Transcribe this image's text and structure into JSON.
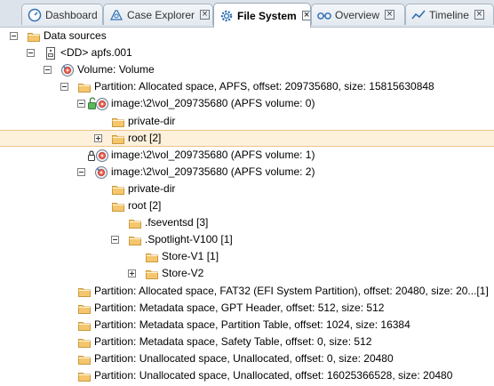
{
  "tabs": [
    {
      "label": "Dashboard",
      "icon": "gauge-icon",
      "closable": false,
      "active": false
    },
    {
      "label": "Case Explorer",
      "icon": "case-explorer-icon",
      "closable": true,
      "active": false
    },
    {
      "label": "File System",
      "icon": "gear-icon",
      "closable": true,
      "active": true
    },
    {
      "label": "Overview",
      "icon": "glasses-icon",
      "closable": true,
      "active": false
    },
    {
      "label": "Timeline",
      "icon": "timeline-icon",
      "closable": true,
      "active": false
    }
  ],
  "tab_close_glyph": "×",
  "tree": [
    {
      "level": 0,
      "toggle": "minus",
      "icon": "folder-icon",
      "label": "Data sources"
    },
    {
      "level": 1,
      "toggle": "minus",
      "icon": "disk-image-icon",
      "label": "<DD> apfs.001"
    },
    {
      "level": 2,
      "toggle": "minus",
      "icon": "volume-icon",
      "label": "Volume: Volume"
    },
    {
      "level": 3,
      "toggle": "minus",
      "icon": "folder-icon",
      "label": "Partition: Allocated space, APFS, offset: 209735680, size: 15815630848"
    },
    {
      "level": 4,
      "toggle": "minus",
      "icon": "unlocked-volume-icon",
      "label": "image:\\2\\vol_209735680 (APFS volume: 0)"
    },
    {
      "level": 5,
      "toggle": "none",
      "icon": "folder-icon",
      "label": "private-dir"
    },
    {
      "level": 5,
      "toggle": "plus",
      "icon": "folder-icon",
      "label": "root [2]",
      "selected": true
    },
    {
      "level": 4,
      "toggle": "none",
      "icon": "locked-volume-icon",
      "label": "image:\\2\\vol_209735680 (APFS volume: 1)"
    },
    {
      "level": 4,
      "toggle": "minus",
      "icon": "volume-icon",
      "label": "image:\\2\\vol_209735680 (APFS volume: 2)"
    },
    {
      "level": 5,
      "toggle": "none",
      "icon": "folder-icon",
      "label": "private-dir"
    },
    {
      "level": 5,
      "toggle": "none",
      "icon": "folder-icon",
      "label": "root [2]"
    },
    {
      "level": 6,
      "toggle": "none",
      "icon": "folder-icon",
      "label": ".fseventsd [3]"
    },
    {
      "level": 6,
      "toggle": "minus",
      "icon": "folder-icon",
      "label": ".Spotlight-V100 [1]"
    },
    {
      "level": 7,
      "toggle": "none",
      "icon": "folder-icon",
      "label": "Store-V1 [1]"
    },
    {
      "level": 7,
      "toggle": "plus",
      "icon": "folder-icon",
      "label": "Store-V2"
    },
    {
      "level": 3,
      "toggle": "none",
      "icon": "folder-icon",
      "label": "Partition: Allocated space, FAT32 (EFI System Partition), offset: 20480, size: 20...[1]"
    },
    {
      "level": 3,
      "toggle": "none",
      "icon": "folder-icon",
      "label": "Partition: Metadata space, GPT Header, offset: 512, size: 512"
    },
    {
      "level": 3,
      "toggle": "none",
      "icon": "folder-icon",
      "label": "Partition: Metadata space, Partition Table, offset: 1024, size: 16384"
    },
    {
      "level": 3,
      "toggle": "none",
      "icon": "folder-icon",
      "label": "Partition: Metadata space, Safety Table, offset: 0, size: 512"
    },
    {
      "level": 3,
      "toggle": "none",
      "icon": "folder-icon",
      "label": "Partition: Unallocated space, Unallocated, offset: 0, size: 20480"
    },
    {
      "level": 3,
      "toggle": "none",
      "icon": "folder-icon",
      "label": "Partition: Unallocated space, Unallocated, offset: 16025366528, size: 20480"
    }
  ],
  "colors": {
    "folder": "#f5c66d",
    "folder_border": "#c99a3c",
    "selection_bg": "#fdf1dc",
    "selection_border": "#efc487",
    "tab_accent": "#2f6fb3"
  }
}
